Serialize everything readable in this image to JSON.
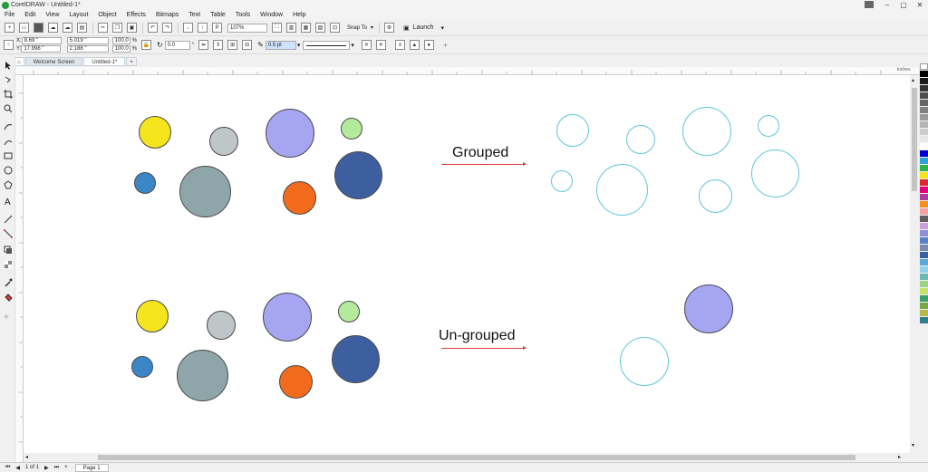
{
  "app": {
    "title": "CorelDRAW - Untitled-1*"
  },
  "menu": [
    "File",
    "Edit",
    "View",
    "Layout",
    "Object",
    "Effects",
    "Bitmaps",
    "Text",
    "Table",
    "Tools",
    "Window",
    "Help"
  ],
  "toolbar": {
    "zoom": "107%",
    "snap_to": "Snap To",
    "launch": "Launch"
  },
  "propbar": {
    "x_label": "X:",
    "x_value": "8.69 \"",
    "y_label": "Y:",
    "y_value": "17.998 \"",
    "w_value": "5.019 \"",
    "h_value": "2.188 \"",
    "scale_x": "100.0",
    "scale_y": "100.0",
    "pct": "%",
    "rotation": "0.0",
    "rotation_unit": "°",
    "outline_width": "0.5 pt"
  },
  "tabs": {
    "welcome": "Welcome Screen",
    "doc": "Untitled-1*"
  },
  "canvas": {
    "label_grouped": "Grouped",
    "label_ungrouped": "Un-grouped"
  },
  "colors": {
    "yellow": "#f5e51c",
    "gray_light": "#bfc6c8",
    "lavender": "#a5a5f2",
    "green": "#b4ea9c",
    "blue_small": "#3a86c6",
    "gray_teal": "#8ea6a9",
    "orange": "#f26b1d",
    "navy": "#3e5f9f",
    "outline_cyan": "#5fc5d8",
    "arrow_red": "#e23c3c"
  },
  "pagebar": {
    "page_count": "1 of 1",
    "page_tab": "Page 1"
  },
  "ruler": {
    "unit": "inches"
  }
}
